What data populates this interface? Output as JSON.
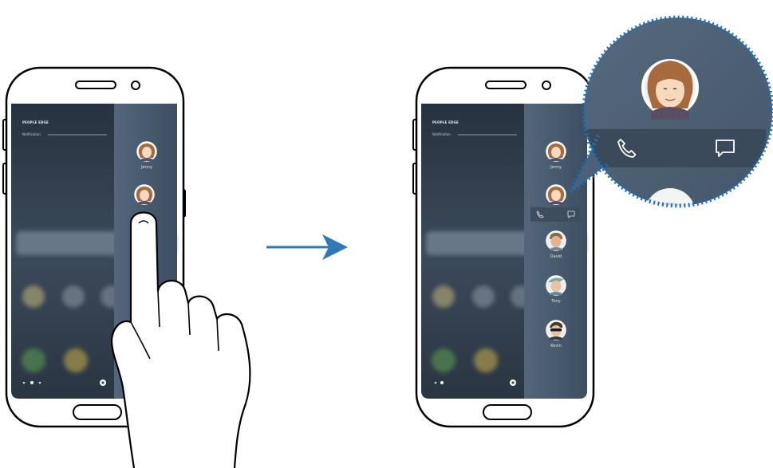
{
  "figure": {
    "left_phone": {
      "panel_title": "PEOPLE EDGE",
      "panel_subtitle": "Notification",
      "edge_contacts": [
        {
          "name": "Jenny",
          "avatar": "avatar-woman-icon"
        },
        {
          "name": "",
          "avatar": "avatar-woman-icon"
        }
      ],
      "gesture": "tap-hand-icon"
    },
    "arrow": "arrow-right-icon",
    "right_phone": {
      "panel_title": "PEOPLE EDGE",
      "panel_subtitle": "Notification",
      "edge_contacts": [
        {
          "name": "Jenny",
          "avatar": "avatar-woman-icon"
        },
        {
          "name": "",
          "avatar": "avatar-woman-icon",
          "actions": [
            "phone-icon",
            "message-icon"
          ]
        },
        {
          "name": "David",
          "avatar": "avatar-man-icon"
        },
        {
          "name": "Tony",
          "avatar": "avatar-man-icon"
        },
        {
          "name": "Kevin",
          "avatar": "avatar-man-sunglasses-icon"
        }
      ]
    },
    "zoom_callout": {
      "actions": [
        "phone-icon",
        "message-icon"
      ]
    }
  },
  "colors": {
    "phone_frame": "#ffffff",
    "phone_outline": "#000000",
    "screen_dark": "#2b3a4b",
    "edge_panel": "#4c5f74",
    "arrow": "#2f79b9",
    "callout_border": "#1f6fb5",
    "callout_bg": "#4f6378"
  }
}
